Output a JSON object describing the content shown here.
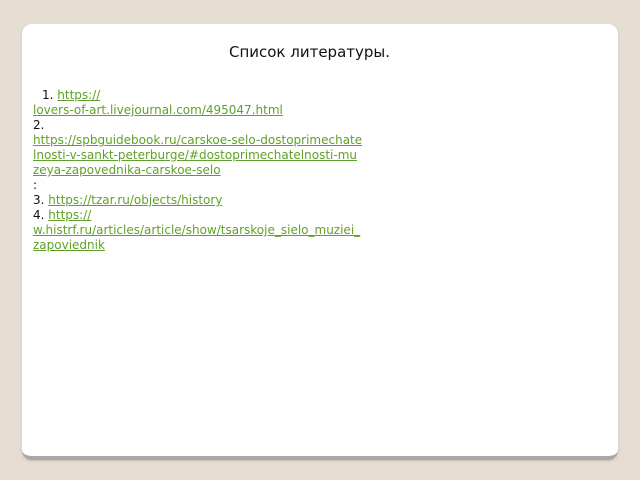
{
  "slide": {
    "title": "Список литературы.",
    "references": [
      {
        "number": "1.",
        "link_part1": "https://",
        "link_part2": "lovers-of-art.livejournal.com/495047.html"
      },
      {
        "number": "2.",
        "link": "https://spbguidebook.ru/carskoe-selo-dostoprimechatelnosti-v-sankt-peterburge/#dostoprimechatelnosti-muzeya-zapovednika-carskoe-selo",
        "suffix": ":"
      },
      {
        "number": "3.",
        "link": "https://tzar.ru/objects/history"
      },
      {
        "number": "4.",
        "link_part1": "https://",
        "link_part2": "w.histrf.ru/articles/article/show/tsarskoje_sielo_muziei_zapoviednik"
      }
    ]
  },
  "colors": {
    "background": "#e5ddd2",
    "card": "#ffffff",
    "link": "#5fa128",
    "text": "#111111"
  }
}
